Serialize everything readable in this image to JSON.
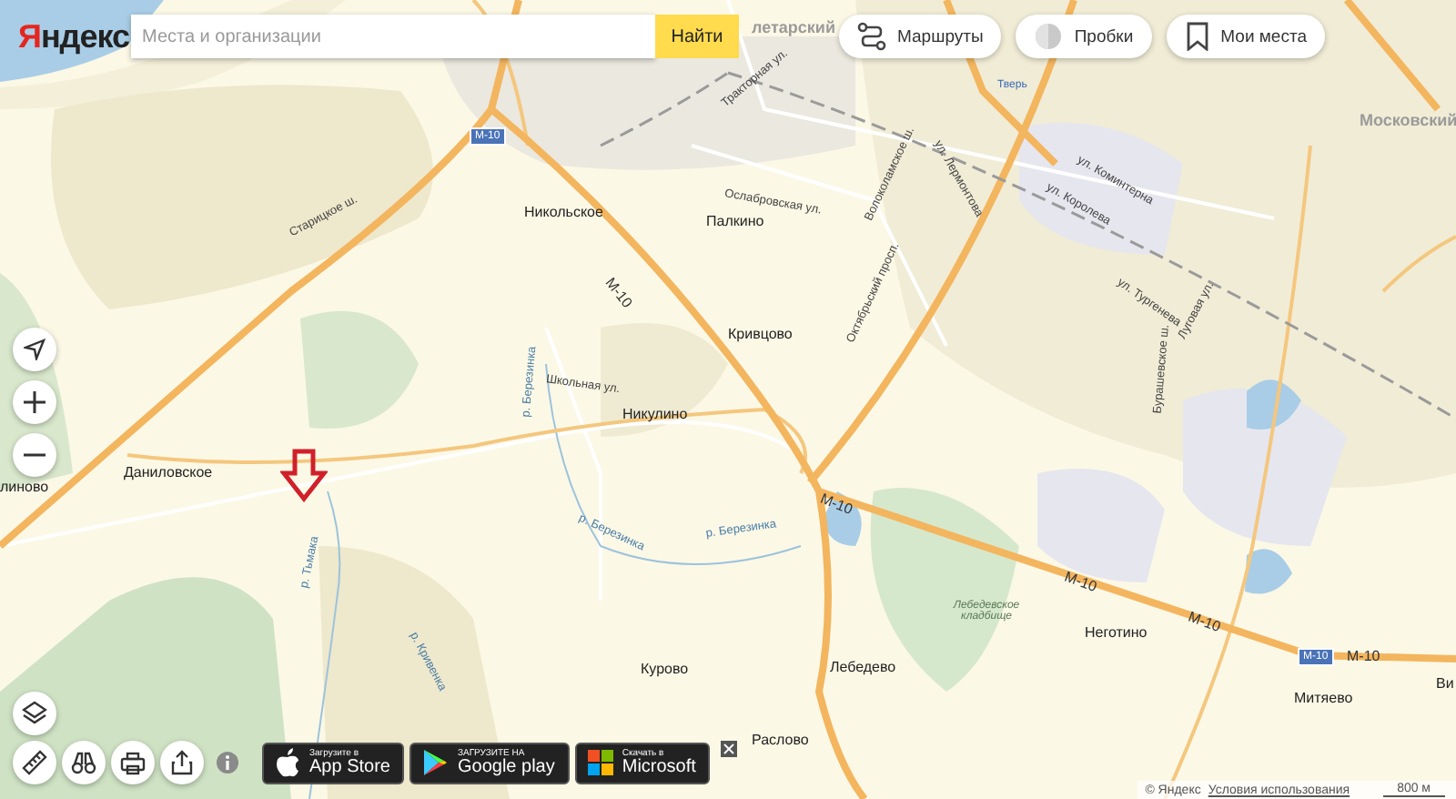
{
  "header": {
    "logo": "Яндекс",
    "search": {
      "placeholder": "Места и организации"
    },
    "search_button": "Найти"
  },
  "map_buttons": [
    {
      "label": "Маршруты",
      "kind": "routes"
    },
    {
      "label": "Пробки",
      "kind": "traffic"
    },
    {
      "label": "Мои места",
      "kind": "bookmarks"
    }
  ],
  "map_labels": [
    {
      "text": "Никольское",
      "kind": "settlement"
    },
    {
      "text": "Палкино",
      "kind": "settlement"
    },
    {
      "text": "Кривцово",
      "kind": "settlement"
    },
    {
      "text": "Никулино",
      "kind": "settlement"
    },
    {
      "text": "Даниловское",
      "kind": "settlement"
    },
    {
      "text": "линово",
      "kind": "settlement"
    },
    {
      "text": "Курово",
      "kind": "settlement"
    },
    {
      "text": "Лебедево",
      "kind": "settlement"
    },
    {
      "text": "Раслово",
      "kind": "settlement"
    },
    {
      "text": "Неготино",
      "kind": "settlement"
    },
    {
      "text": "Митяево",
      "kind": "settlement"
    },
    {
      "text": "Ви",
      "kind": "settlement"
    },
    {
      "text": "Московский",
      "kind": "district"
    },
    {
      "text": "летарский",
      "kind": "district"
    },
    {
      "text": "Тверь",
      "kind": "station"
    },
    {
      "text": "Старицкое ш.",
      "kind": "street"
    },
    {
      "text": "Школьная ул.",
      "kind": "street"
    },
    {
      "text": "Ослабровская ул.",
      "kind": "street"
    },
    {
      "text": "Тракторная ул.",
      "kind": "street"
    },
    {
      "text": "ул. Лермонтова",
      "kind": "street"
    },
    {
      "text": "Волоколамское ш.",
      "kind": "street"
    },
    {
      "text": "Октябрьский просп.",
      "kind": "street"
    },
    {
      "text": "ул. Коминтерна",
      "kind": "street"
    },
    {
      "text": "ул. Королева",
      "kind": "street"
    },
    {
      "text": "ул. Тургенева",
      "kind": "street"
    },
    {
      "text": "Бурашевское ш.",
      "kind": "street"
    },
    {
      "text": "Луговая ул.",
      "kind": "street"
    },
    {
      "text": "р. Березинка",
      "kind": "river"
    },
    {
      "text": "р. Березинка",
      "kind": "river"
    },
    {
      "text": "р. Березинка",
      "kind": "river"
    },
    {
      "text": "р. Тьмака",
      "kind": "river"
    },
    {
      "text": "р. Кривенка",
      "kind": "river"
    },
    {
      "text": "Лебедевское кладбище",
      "kind": "area"
    },
    {
      "text": "М-10",
      "kind": "shield"
    },
    {
      "text": "М-10",
      "kind": "shield"
    },
    {
      "text": "М-10",
      "kind": "road"
    },
    {
      "text": "М-10",
      "kind": "road"
    },
    {
      "text": "М-10",
      "kind": "road"
    },
    {
      "text": "М-10",
      "kind": "road"
    },
    {
      "text": "М-10",
      "kind": "road"
    }
  ],
  "app_badges": [
    {
      "small": "Загрузите в",
      "big": "App Store",
      "kind": "apple"
    },
    {
      "small": "ЗАГРУЗИТЕ НА",
      "big": "Google play",
      "kind": "google"
    },
    {
      "small": "Скачать в",
      "big": "Microsoft",
      "kind": "microsoft"
    }
  ],
  "footer": {
    "copyright": "© Яндекс",
    "terms_link": "Условия использования",
    "scale": "800 м"
  }
}
